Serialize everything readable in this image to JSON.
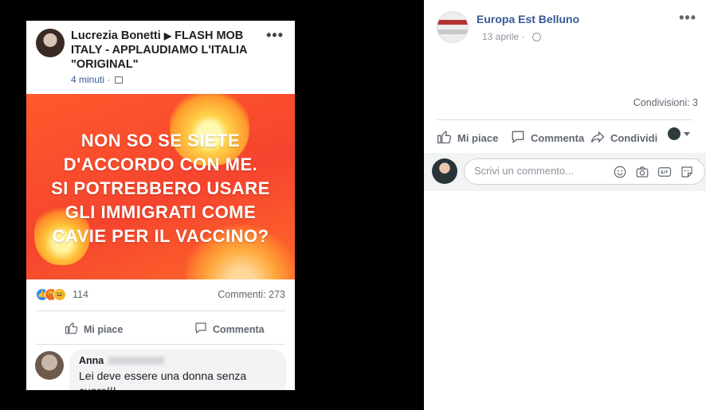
{
  "screenshot": {
    "post": {
      "author": "Lucrezia Bonetti",
      "arrow": "▶",
      "group": "FLASH MOB ITALY - APPLAUDIAMO L'ITALIA \"ORIGINAL\"",
      "time": "4 minuti",
      "image_text": "NON SO SE SIETE D'ACCORDO CON ME. SI POTREBBERO USARE GLI IMMIGRATI COME CAVIE PER IL VACCINO?",
      "image_lines": [
        "NON SO SE SIETE",
        "D'ACCORDO CON ME.",
        "SI POTREBBERO USARE",
        "GLI IMMIGRATI COME",
        "CAVIE PER IL VACCINO?"
      ],
      "reactions_count": "114",
      "comments_count": "Commenti: 273",
      "like_label": "Mi piace",
      "comment_label": "Commenta",
      "comment": {
        "author": "Anna",
        "text": "Lei deve essere una donna senza cuore!!!"
      }
    }
  },
  "page": {
    "name": "Europa Est Belluno",
    "date": "13 aprile",
    "shares": "Condivisioni: 3",
    "actions": {
      "like": "Mi piace",
      "comment": "Commenta",
      "share": "Condividi"
    },
    "composer": {
      "placeholder": "Scrivi un commento..."
    }
  },
  "colors": {
    "link": "#385898",
    "image_bg": "#f5442e",
    "text_secondary": "#606770"
  }
}
